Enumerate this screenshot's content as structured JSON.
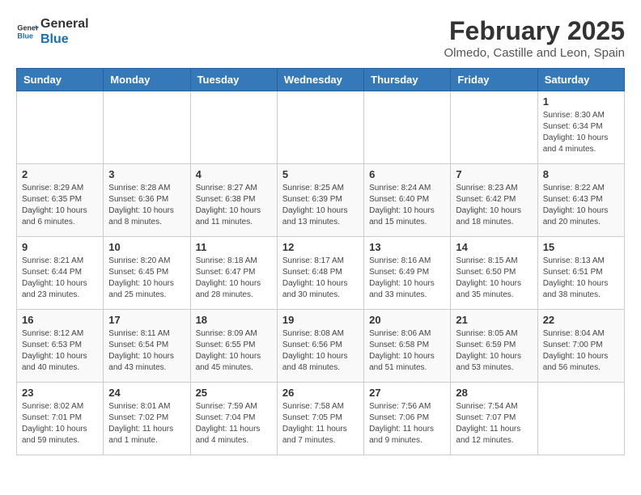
{
  "header": {
    "logo_line1": "General",
    "logo_line2": "Blue",
    "title": "February 2025",
    "subtitle": "Olmedo, Castille and Leon, Spain"
  },
  "weekdays": [
    "Sunday",
    "Monday",
    "Tuesday",
    "Wednesday",
    "Thursday",
    "Friday",
    "Saturday"
  ],
  "weeks": [
    [
      {
        "day": "",
        "info": ""
      },
      {
        "day": "",
        "info": ""
      },
      {
        "day": "",
        "info": ""
      },
      {
        "day": "",
        "info": ""
      },
      {
        "day": "",
        "info": ""
      },
      {
        "day": "",
        "info": ""
      },
      {
        "day": "1",
        "info": "Sunrise: 8:30 AM\nSunset: 6:34 PM\nDaylight: 10 hours\nand 4 minutes."
      }
    ],
    [
      {
        "day": "2",
        "info": "Sunrise: 8:29 AM\nSunset: 6:35 PM\nDaylight: 10 hours\nand 6 minutes."
      },
      {
        "day": "3",
        "info": "Sunrise: 8:28 AM\nSunset: 6:36 PM\nDaylight: 10 hours\nand 8 minutes."
      },
      {
        "day": "4",
        "info": "Sunrise: 8:27 AM\nSunset: 6:38 PM\nDaylight: 10 hours\nand 11 minutes."
      },
      {
        "day": "5",
        "info": "Sunrise: 8:25 AM\nSunset: 6:39 PM\nDaylight: 10 hours\nand 13 minutes."
      },
      {
        "day": "6",
        "info": "Sunrise: 8:24 AM\nSunset: 6:40 PM\nDaylight: 10 hours\nand 15 minutes."
      },
      {
        "day": "7",
        "info": "Sunrise: 8:23 AM\nSunset: 6:42 PM\nDaylight: 10 hours\nand 18 minutes."
      },
      {
        "day": "8",
        "info": "Sunrise: 8:22 AM\nSunset: 6:43 PM\nDaylight: 10 hours\nand 20 minutes."
      }
    ],
    [
      {
        "day": "9",
        "info": "Sunrise: 8:21 AM\nSunset: 6:44 PM\nDaylight: 10 hours\nand 23 minutes."
      },
      {
        "day": "10",
        "info": "Sunrise: 8:20 AM\nSunset: 6:45 PM\nDaylight: 10 hours\nand 25 minutes."
      },
      {
        "day": "11",
        "info": "Sunrise: 8:18 AM\nSunset: 6:47 PM\nDaylight: 10 hours\nand 28 minutes."
      },
      {
        "day": "12",
        "info": "Sunrise: 8:17 AM\nSunset: 6:48 PM\nDaylight: 10 hours\nand 30 minutes."
      },
      {
        "day": "13",
        "info": "Sunrise: 8:16 AM\nSunset: 6:49 PM\nDaylight: 10 hours\nand 33 minutes."
      },
      {
        "day": "14",
        "info": "Sunrise: 8:15 AM\nSunset: 6:50 PM\nDaylight: 10 hours\nand 35 minutes."
      },
      {
        "day": "15",
        "info": "Sunrise: 8:13 AM\nSunset: 6:51 PM\nDaylight: 10 hours\nand 38 minutes."
      }
    ],
    [
      {
        "day": "16",
        "info": "Sunrise: 8:12 AM\nSunset: 6:53 PM\nDaylight: 10 hours\nand 40 minutes."
      },
      {
        "day": "17",
        "info": "Sunrise: 8:11 AM\nSunset: 6:54 PM\nDaylight: 10 hours\nand 43 minutes."
      },
      {
        "day": "18",
        "info": "Sunrise: 8:09 AM\nSunset: 6:55 PM\nDaylight: 10 hours\nand 45 minutes."
      },
      {
        "day": "19",
        "info": "Sunrise: 8:08 AM\nSunset: 6:56 PM\nDaylight: 10 hours\nand 48 minutes."
      },
      {
        "day": "20",
        "info": "Sunrise: 8:06 AM\nSunset: 6:58 PM\nDaylight: 10 hours\nand 51 minutes."
      },
      {
        "day": "21",
        "info": "Sunrise: 8:05 AM\nSunset: 6:59 PM\nDaylight: 10 hours\nand 53 minutes."
      },
      {
        "day": "22",
        "info": "Sunrise: 8:04 AM\nSunset: 7:00 PM\nDaylight: 10 hours\nand 56 minutes."
      }
    ],
    [
      {
        "day": "23",
        "info": "Sunrise: 8:02 AM\nSunset: 7:01 PM\nDaylight: 10 hours\nand 59 minutes."
      },
      {
        "day": "24",
        "info": "Sunrise: 8:01 AM\nSunset: 7:02 PM\nDaylight: 11 hours\nand 1 minute."
      },
      {
        "day": "25",
        "info": "Sunrise: 7:59 AM\nSunset: 7:04 PM\nDaylight: 11 hours\nand 4 minutes."
      },
      {
        "day": "26",
        "info": "Sunrise: 7:58 AM\nSunset: 7:05 PM\nDaylight: 11 hours\nand 7 minutes."
      },
      {
        "day": "27",
        "info": "Sunrise: 7:56 AM\nSunset: 7:06 PM\nDaylight: 11 hours\nand 9 minutes."
      },
      {
        "day": "28",
        "info": "Sunrise: 7:54 AM\nSunset: 7:07 PM\nDaylight: 11 hours\nand 12 minutes."
      },
      {
        "day": "",
        "info": ""
      }
    ]
  ]
}
